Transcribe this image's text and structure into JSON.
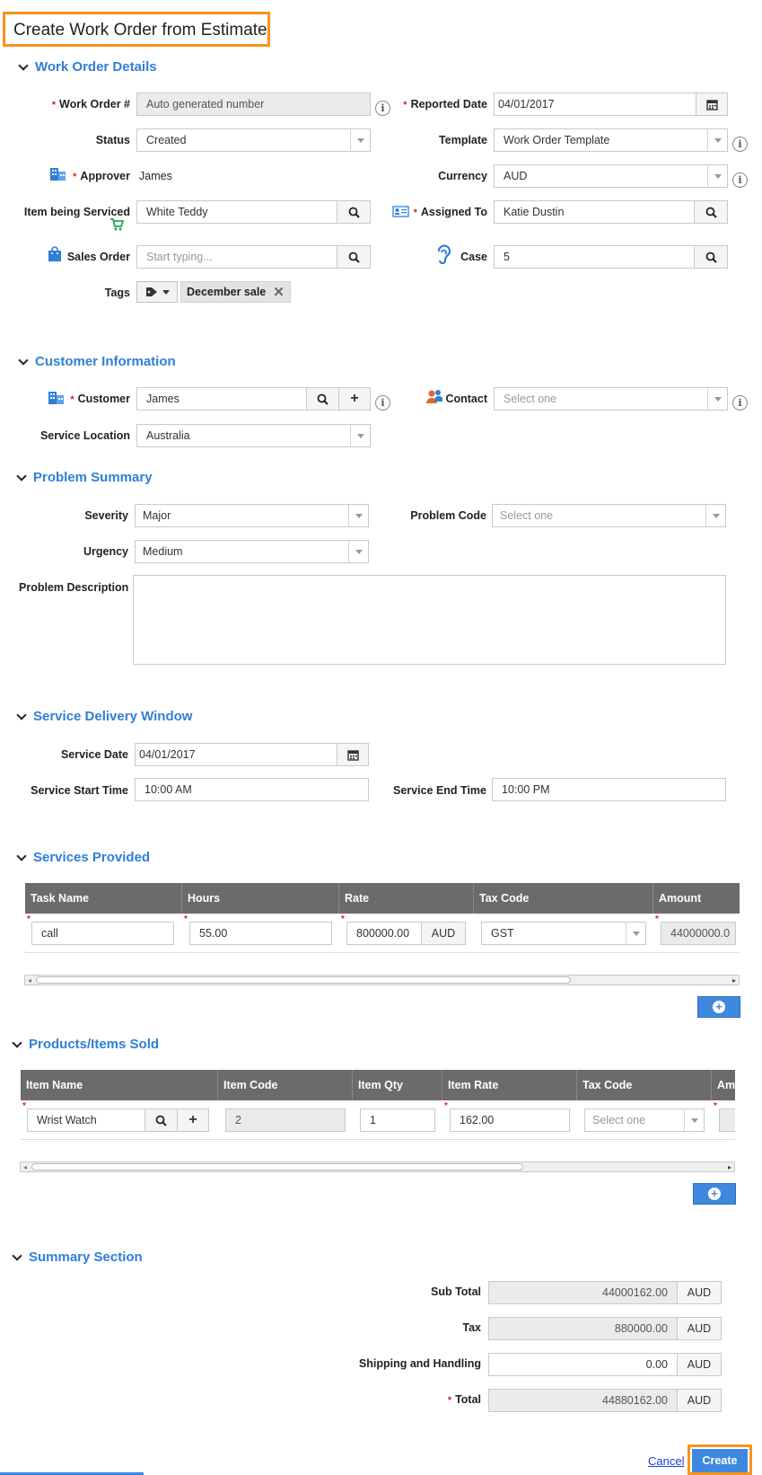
{
  "page_title": "Create Work Order from Estimate",
  "colors": {
    "accent": "#2f7fd6",
    "highlight_border": "#f7941d",
    "primary_button": "#3f88e0",
    "required": "#d9231d"
  },
  "work_order_details": {
    "title": "Work Order Details",
    "work_order_label": "Work Order #",
    "work_order_placeholder": "Auto generated number",
    "reported_date_label": "Reported Date",
    "reported_date": "04/01/2017",
    "status_label": "Status",
    "status": "Created",
    "template_label": "Template",
    "template": "Work Order Template",
    "approver_label": "Approver",
    "approver": "James",
    "currency_label": "Currency",
    "currency": "AUD",
    "item_label": "Item being Serviced",
    "item": "White Teddy",
    "assigned_label": "Assigned To",
    "assigned": "Katie Dustin",
    "sales_order_label": "Sales Order",
    "sales_order_placeholder": "Start typing...",
    "case_label": "Case",
    "case": "5",
    "tags_label": "Tags",
    "tags": [
      "December sale"
    ]
  },
  "customer_information": {
    "title": "Customer Information",
    "customer_label": "Customer",
    "customer": "James",
    "contact_label": "Contact",
    "contact_placeholder": "Select one",
    "service_location_label": "Service Location",
    "service_location": "Australia"
  },
  "problem_summary": {
    "title": "Problem Summary",
    "severity_label": "Severity",
    "severity": "Major",
    "problem_code_label": "Problem Code",
    "problem_code_placeholder": "Select one",
    "urgency_label": "Urgency",
    "urgency": "Medium",
    "description_label": "Problem Description",
    "description": ""
  },
  "service_delivery_window": {
    "title": "Service Delivery Window",
    "service_date_label": "Service Date",
    "service_date": "04/01/2017",
    "start_time_label": "Service Start Time",
    "start_time": "10:00 AM",
    "end_time_label": "Service End Time",
    "end_time": "10:00 PM"
  },
  "services_provided": {
    "title": "Services Provided",
    "columns": [
      "Task Name",
      "Hours",
      "Rate",
      "Tax Code",
      "Amount"
    ],
    "rows": [
      {
        "task_name": "call",
        "hours": "55.00",
        "rate": "800000.00",
        "rate_currency": "AUD",
        "tax_code": "GST",
        "amount": "44000000.0"
      }
    ]
  },
  "products_items_sold": {
    "title": "Products/Items Sold",
    "columns": [
      "Item Name",
      "Item Code",
      "Item Qty",
      "Item Rate",
      "Tax Code",
      "Amo"
    ],
    "rows": [
      {
        "item_name": "Wrist Watch",
        "item_code": "2",
        "item_qty": "1",
        "item_rate": "162.00",
        "tax_code_placeholder": "Select one"
      }
    ]
  },
  "summary_section": {
    "title": "Summary Section",
    "sub_total_label": "Sub Total",
    "sub_total": "44000162.00",
    "tax_label": "Tax",
    "tax": "880000.00",
    "shipping_label": "Shipping and Handling",
    "shipping": "0.00",
    "total_label": "Total",
    "total": "44880162.00",
    "currency": "AUD"
  },
  "footer": {
    "cancel_label": "Cancel",
    "create_label": "Create"
  }
}
